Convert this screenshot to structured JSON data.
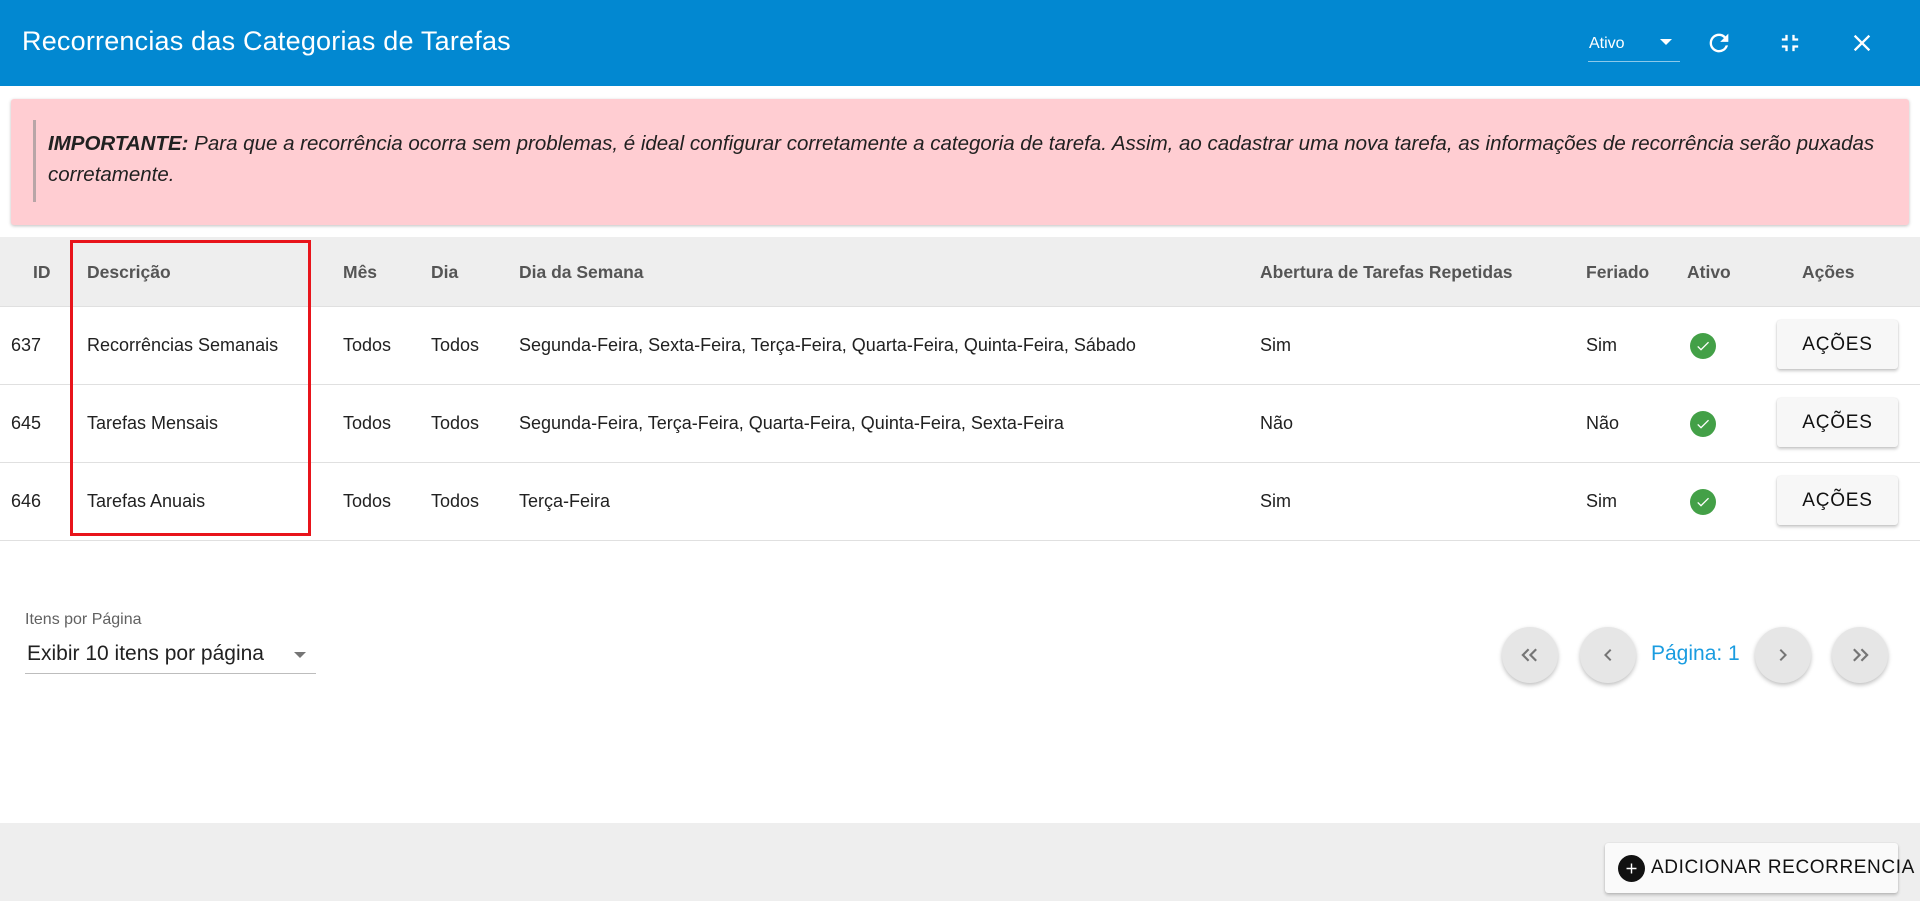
{
  "header": {
    "title": "Recorrencias das Categorias de Tarefas",
    "status_filter": "Ativo",
    "icons": [
      "refresh-icon",
      "collapse-icon",
      "close-icon"
    ],
    "color": "#0288d1"
  },
  "alert": {
    "strong": "IMPORTANTE:",
    "message": "Para que a recorrência ocorra sem problemas, é ideal configurar corretamente a categoria de tarefa. Assim, ao cadastrar uma nova tarefa, as informações de recorrência serão puxadas corretamente.",
    "background": "#ffcdd2"
  },
  "table": {
    "headers": {
      "id": "ID",
      "descricao": "Descrição",
      "mes": "Mês",
      "dia": "Dia",
      "dia_semana": "Dia da Semana",
      "abertura": "Abertura de Tarefas Repetidas",
      "feriado": "Feriado",
      "ativo": "Ativo",
      "acoes": "Ações"
    },
    "rows": [
      {
        "id": "637",
        "descricao": "Recorrências Semanais",
        "mes": "Todos",
        "dia": "Todos",
        "dia_semana": "Segunda-Feira, Sexta-Feira, Terça-Feira, Quarta-Feira, Quinta-Feira, Sábado",
        "abertura": "Sim",
        "feriado": "Sim",
        "ativo": true,
        "acoes": "AÇÕES"
      },
      {
        "id": "645",
        "descricao": "Tarefas Mensais",
        "mes": "Todos",
        "dia": "Todos",
        "dia_semana": "Segunda-Feira, Terça-Feira, Quarta-Feira, Quinta-Feira, Sexta-Feira",
        "abertura": "Não",
        "feriado": "Não",
        "ativo": true,
        "acoes": "AÇÕES"
      },
      {
        "id": "646",
        "descricao": "Tarefas Anuais",
        "mes": "Todos",
        "dia": "Todos",
        "dia_semana": "Terça-Feira",
        "abertura": "Sim",
        "feriado": "Sim",
        "ativo": true,
        "acoes": "AÇÕES"
      }
    ],
    "active_icon_color": "#43a047",
    "highlight_color": "#e8141b"
  },
  "pagination": {
    "per_page_label": "Itens por Página",
    "per_page_value": "Exibir 10 itens por página",
    "page_label": "Página: 1"
  },
  "footer": {
    "add_button": "ADICIONAR RECORRENCIA"
  }
}
